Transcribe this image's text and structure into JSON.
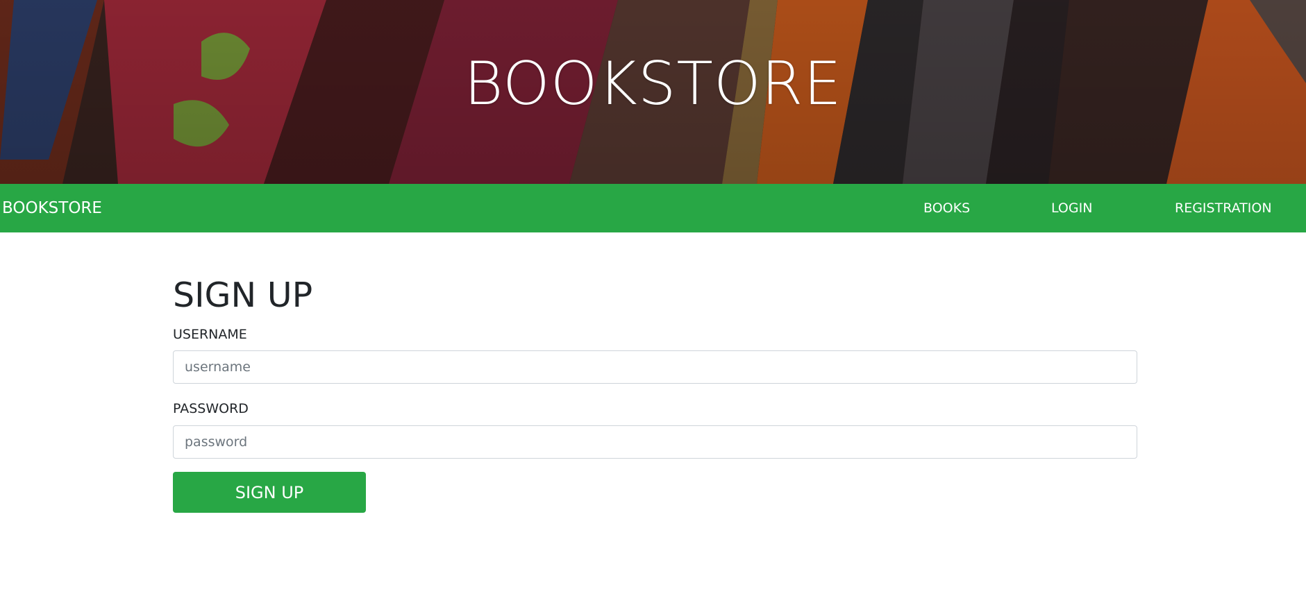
{
  "header": {
    "hero_title": "BOOKSTORE"
  },
  "navbar": {
    "brand": "BOOKSTORE",
    "links": [
      "BOOKS",
      "LOGIN",
      "REGISTRATION"
    ],
    "background_color": "#28a745"
  },
  "signup_form": {
    "title": "SIGN UP",
    "username_label": "USERNAME",
    "username_placeholder": "username",
    "username_value": "",
    "password_label": "PASSWORD",
    "password_placeholder": "password",
    "password_value": "",
    "submit_label": "SIGN UP"
  }
}
